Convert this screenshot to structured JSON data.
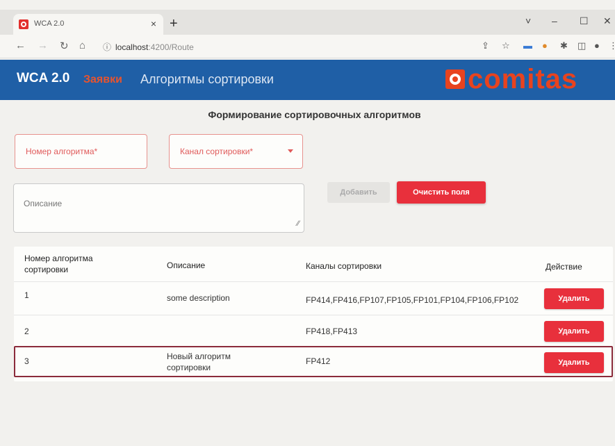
{
  "browser": {
    "tab_title": "WCA 2.0",
    "tab_close": "×",
    "new_tab": "+",
    "url_host": "localhost",
    "url_path": ":4200/Route",
    "window_controls": [
      "˅",
      "–",
      "☐",
      "✕"
    ]
  },
  "header": {
    "brand": "WCA 2.0",
    "nav": [
      "Заявки",
      "Алгоритмы сортировки"
    ],
    "logo": "comitas"
  },
  "page": {
    "title": "Формирование сортировочных алгоритмов"
  },
  "form": {
    "algo_number_placeholder": "Номер алгоритма*",
    "channel_placeholder": "Канал сортировки*",
    "description_placeholder": "Описание",
    "add_label": "Добавить",
    "clear_label": "Очистить поля"
  },
  "table": {
    "headers": [
      "Номер алгоритма сортировки",
      "Описание",
      "Каналы сортировки",
      "Действие"
    ],
    "rows": [
      {
        "number": "1",
        "description": "some description",
        "channels": "FP414,FP416,FP107,FP105,FP101,FP104,FP106,FP102",
        "action": "Удалить"
      },
      {
        "number": "2",
        "description": "",
        "channels": "FP418,FP413",
        "action": "Удалить"
      },
      {
        "number": "3",
        "description": "Новый алгоритм сортировки",
        "channels": "FP412",
        "action": "Удалить"
      }
    ]
  },
  "colors": {
    "header_bg": "#1f5fa6",
    "accent_red": "#e8303c",
    "logo_orange": "#e8431f",
    "highlight_border": "#8b2b3b"
  }
}
